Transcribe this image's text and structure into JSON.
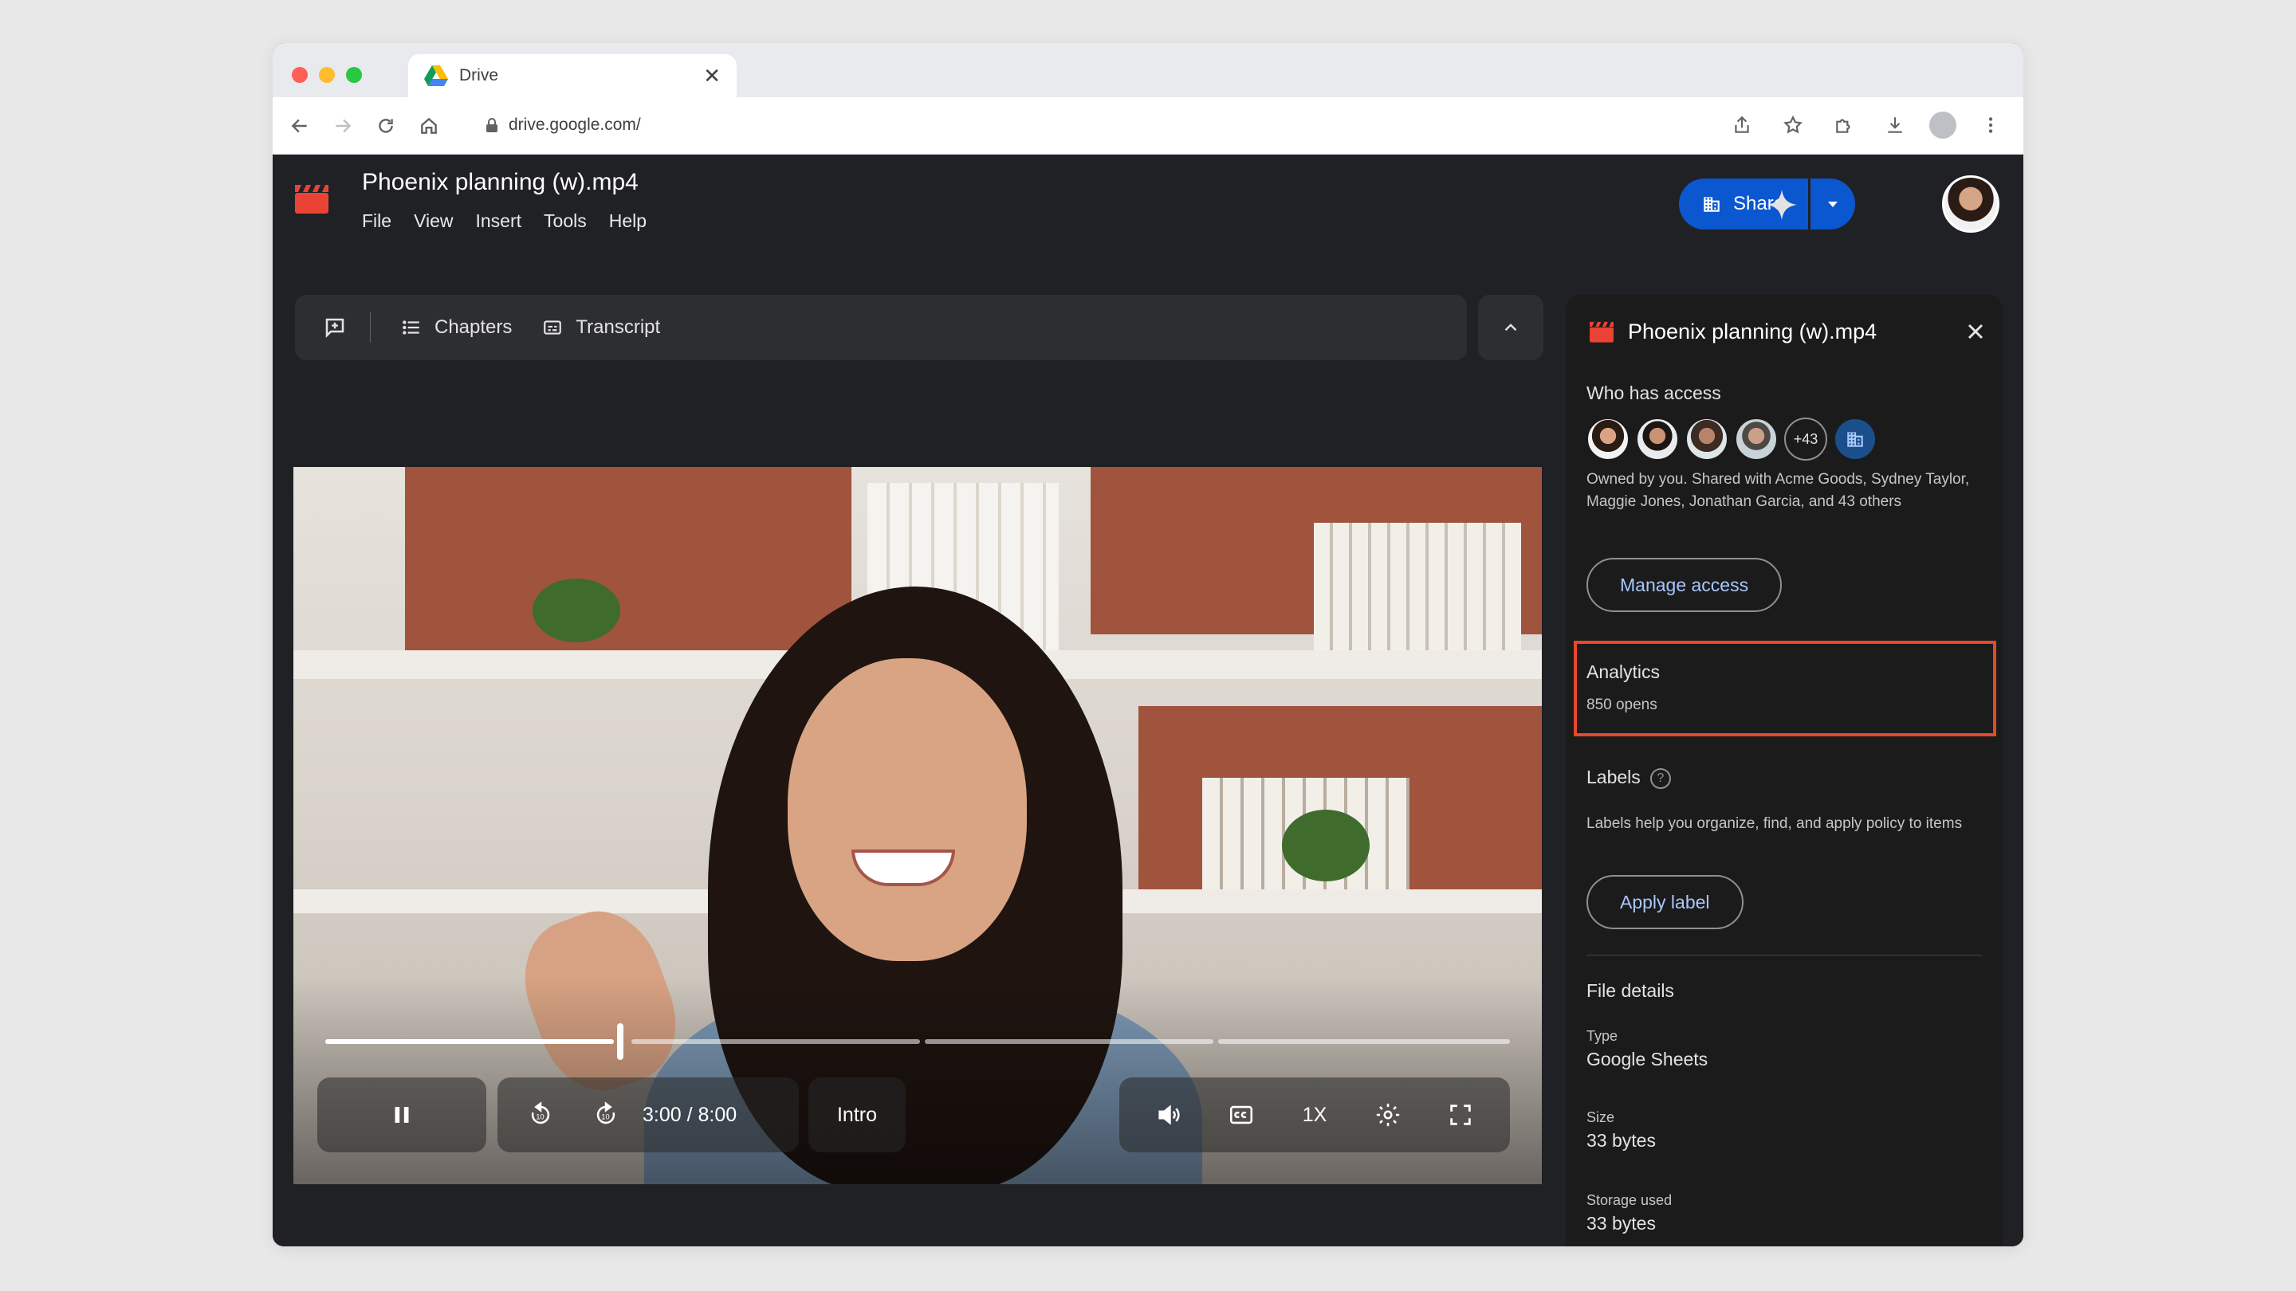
{
  "browser": {
    "tab_title": "Drive",
    "url": "drive.google.com/"
  },
  "app": {
    "file_title": "Phoenix planning (w).mp4",
    "menu": [
      "File",
      "View",
      "Insert",
      "Tools",
      "Help"
    ],
    "share_label": "Share"
  },
  "player_bar": {
    "chapters_label": "Chapters",
    "transcript_label": "Transcript"
  },
  "video": {
    "time_display": "3:00 / 8:00",
    "chapter_label": "Intro",
    "speed_label": "1X",
    "progress_fraction": 0.375
  },
  "panel": {
    "title": "Phoenix planning (w).mp4",
    "who_has_access_label": "Who has access",
    "extra_count": "+43",
    "owned_text": "Owned by you. Shared with Acme Goods, Sydney Taylor, Maggie Jones, Jonathan Garcia, and 43 others",
    "manage_access_label": "Manage access",
    "analytics_label": "Analytics",
    "analytics_value": "850 opens",
    "labels_label": "Labels",
    "labels_help": "?",
    "labels_desc": "Labels help you organize, find, and apply policy to items",
    "apply_label": "Apply label",
    "file_details_label": "File details",
    "type_key": "Type",
    "type_value": "Google Sheets",
    "size_key": "Size",
    "size_value": "33 bytes",
    "storage_key": "Storage used",
    "storage_value": "33 bytes"
  },
  "colors": {
    "share_blue": "#0b57d0",
    "highlight_red": "#e8472c",
    "link_blue": "#a8c7fa",
    "panel_bg": "#1b1b1b",
    "app_bg": "#202124"
  },
  "icons": {
    "video_logo": "clapperboard-icon",
    "share": "building-icon",
    "gemini": "sparkle-icon"
  }
}
